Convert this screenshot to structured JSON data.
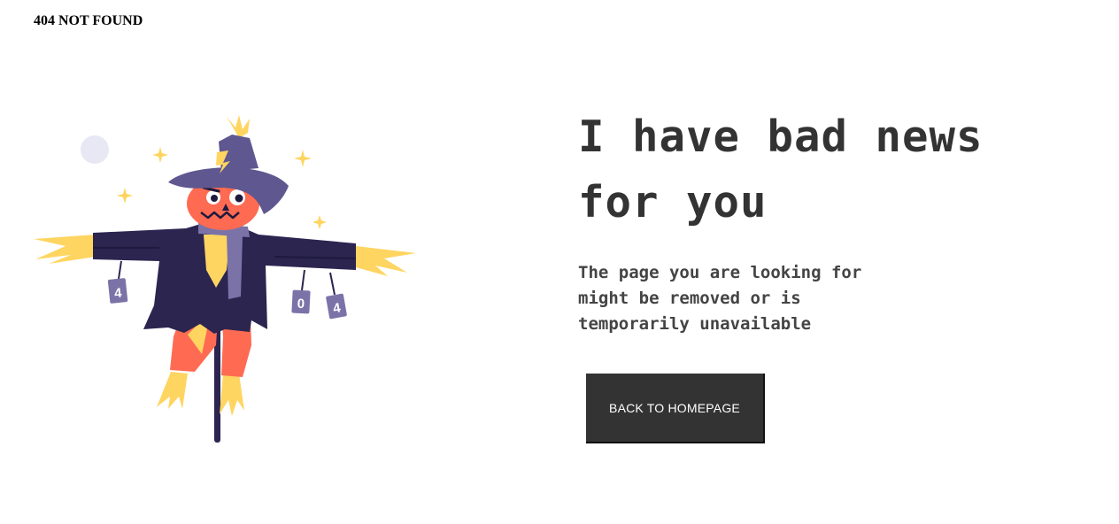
{
  "page": {
    "title": "404 NOT FOUND"
  },
  "main": {
    "headline": "I have bad news for you",
    "message": "The page you are looking for might be removed or is temporarily unavailable",
    "button_label": "BACK TO HOMEPAGE"
  },
  "illustration": {
    "can_labels": [
      "4",
      "0",
      "4"
    ]
  },
  "colors": {
    "text_dark": "#333333",
    "button_bg": "#333333",
    "hat_purple": "#5F5790",
    "coat_navy": "#2B2550",
    "face_orange": "#FF6B52",
    "straw_yellow": "#FFD561",
    "scarf_purple": "#7B73A8"
  }
}
